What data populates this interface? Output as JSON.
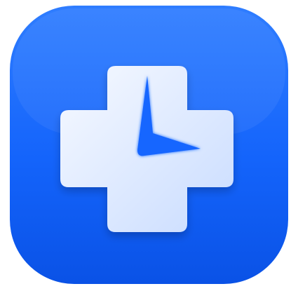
{
  "icon": {
    "name": "medical-cross-clock-app-icon",
    "colors": {
      "background_light": "#2f7dff",
      "background_mid": "#1464fb",
      "background_dark": "#0a52e6",
      "cross_light": "#f6f9ff",
      "cross_shadow": "#c9dcff",
      "clock_hands": "#1466ff"
    }
  }
}
